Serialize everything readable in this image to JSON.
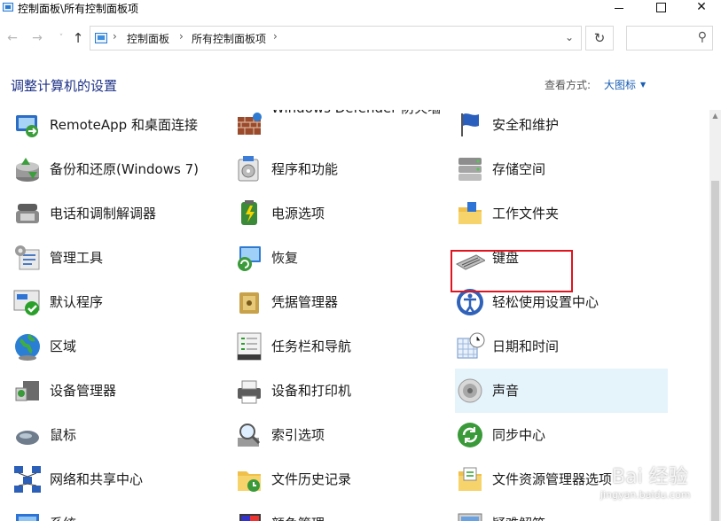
{
  "window": {
    "title": "控制面板\\所有控制面板项",
    "controls": {
      "minimize": "",
      "maximize": "",
      "close": "✕"
    }
  },
  "navigation": {
    "back_icon": "←",
    "forward_icon": "→",
    "recent_icon": "˅",
    "up_icon": "↑",
    "separator": "›",
    "breadcrumbs": [
      "控制面板",
      "所有控制面板项"
    ],
    "dropdown_icon": "⌄",
    "refresh_icon": "↻",
    "search": {
      "placeholder": "",
      "value": "",
      "icon": "⚲"
    }
  },
  "header": {
    "title": "调整计算机的设置",
    "view_by_label": "查看方式:",
    "view_mode": "大图标",
    "view_mode_caret": "▼"
  },
  "items": [
    {
      "label": "RemoteApp 和桌面连接",
      "icon": "remoteapp-icon",
      "col": 0,
      "row": 0
    },
    {
      "label": "Windows Defender 防火墙",
      "icon": "firewall-icon",
      "col": 1,
      "row": 0
    },
    {
      "label": "安全和维护",
      "icon": "security-flag-icon",
      "col": 2,
      "row": 0
    },
    {
      "label": "备份和还原(Windows 7)",
      "icon": "backup-icon",
      "col": 0,
      "row": 1
    },
    {
      "label": "程序和功能",
      "icon": "programs-icon",
      "col": 1,
      "row": 1
    },
    {
      "label": "存储空间",
      "icon": "storage-icon",
      "col": 2,
      "row": 1
    },
    {
      "label": "电话和调制解调器",
      "icon": "phone-modem-icon",
      "col": 0,
      "row": 2
    },
    {
      "label": "电源选项",
      "icon": "power-icon",
      "col": 1,
      "row": 2
    },
    {
      "label": "工作文件夹",
      "icon": "work-folders-icon",
      "col": 2,
      "row": 2
    },
    {
      "label": "管理工具",
      "icon": "admin-tools-icon",
      "col": 0,
      "row": 3
    },
    {
      "label": "恢复",
      "icon": "recovery-icon",
      "col": 1,
      "row": 3
    },
    {
      "label": "键盘",
      "icon": "keyboard-icon",
      "col": 2,
      "row": 3
    },
    {
      "label": "默认程序",
      "icon": "default-programs-icon",
      "col": 0,
      "row": 4
    },
    {
      "label": "凭据管理器",
      "icon": "credential-icon",
      "col": 1,
      "row": 4
    },
    {
      "label": "轻松使用设置中心",
      "icon": "ease-of-access-icon",
      "col": 2,
      "row": 4
    },
    {
      "label": "区域",
      "icon": "region-globe-icon",
      "col": 0,
      "row": 5
    },
    {
      "label": "任务栏和导航",
      "icon": "taskbar-icon",
      "col": 1,
      "row": 5
    },
    {
      "label": "日期和时间",
      "icon": "date-time-icon",
      "col": 2,
      "row": 5
    },
    {
      "label": "设备管理器",
      "icon": "device-manager-icon",
      "col": 0,
      "row": 6
    },
    {
      "label": "设备和打印机",
      "icon": "printer-icon",
      "col": 1,
      "row": 6
    },
    {
      "label": "声音",
      "icon": "speaker-icon",
      "col": 2,
      "row": 6
    },
    {
      "label": "鼠标",
      "icon": "mouse-icon",
      "col": 0,
      "row": 7
    },
    {
      "label": "索引选项",
      "icon": "indexing-icon",
      "col": 1,
      "row": 7
    },
    {
      "label": "同步中心",
      "icon": "sync-icon",
      "col": 2,
      "row": 7
    },
    {
      "label": "网络和共享中心",
      "icon": "network-icon",
      "col": 0,
      "row": 8
    },
    {
      "label": "文件历史记录",
      "icon": "file-history-icon",
      "col": 1,
      "row": 8
    },
    {
      "label": "文件资源管理器选项",
      "icon": "explorer-options-icon",
      "col": 2,
      "row": 8
    },
    {
      "label": "系统",
      "icon": "system-icon",
      "col": 0,
      "row": 9
    },
    {
      "label": "颜色管理",
      "icon": "color-management-icon",
      "col": 1,
      "row": 9
    },
    {
      "label": "疑难解答",
      "icon": "troubleshooting-icon",
      "col": 2,
      "row": 9
    }
  ],
  "highlighted_item": "声音",
  "colors": {
    "title_blue": "#1e3287",
    "link_blue": "#1a5fb4",
    "highlight_red": "#e0141f",
    "hover_bg": "#e5f3fb"
  },
  "watermark": {
    "text": "Bai 经验",
    "url": "jingyan.baidu.com"
  }
}
